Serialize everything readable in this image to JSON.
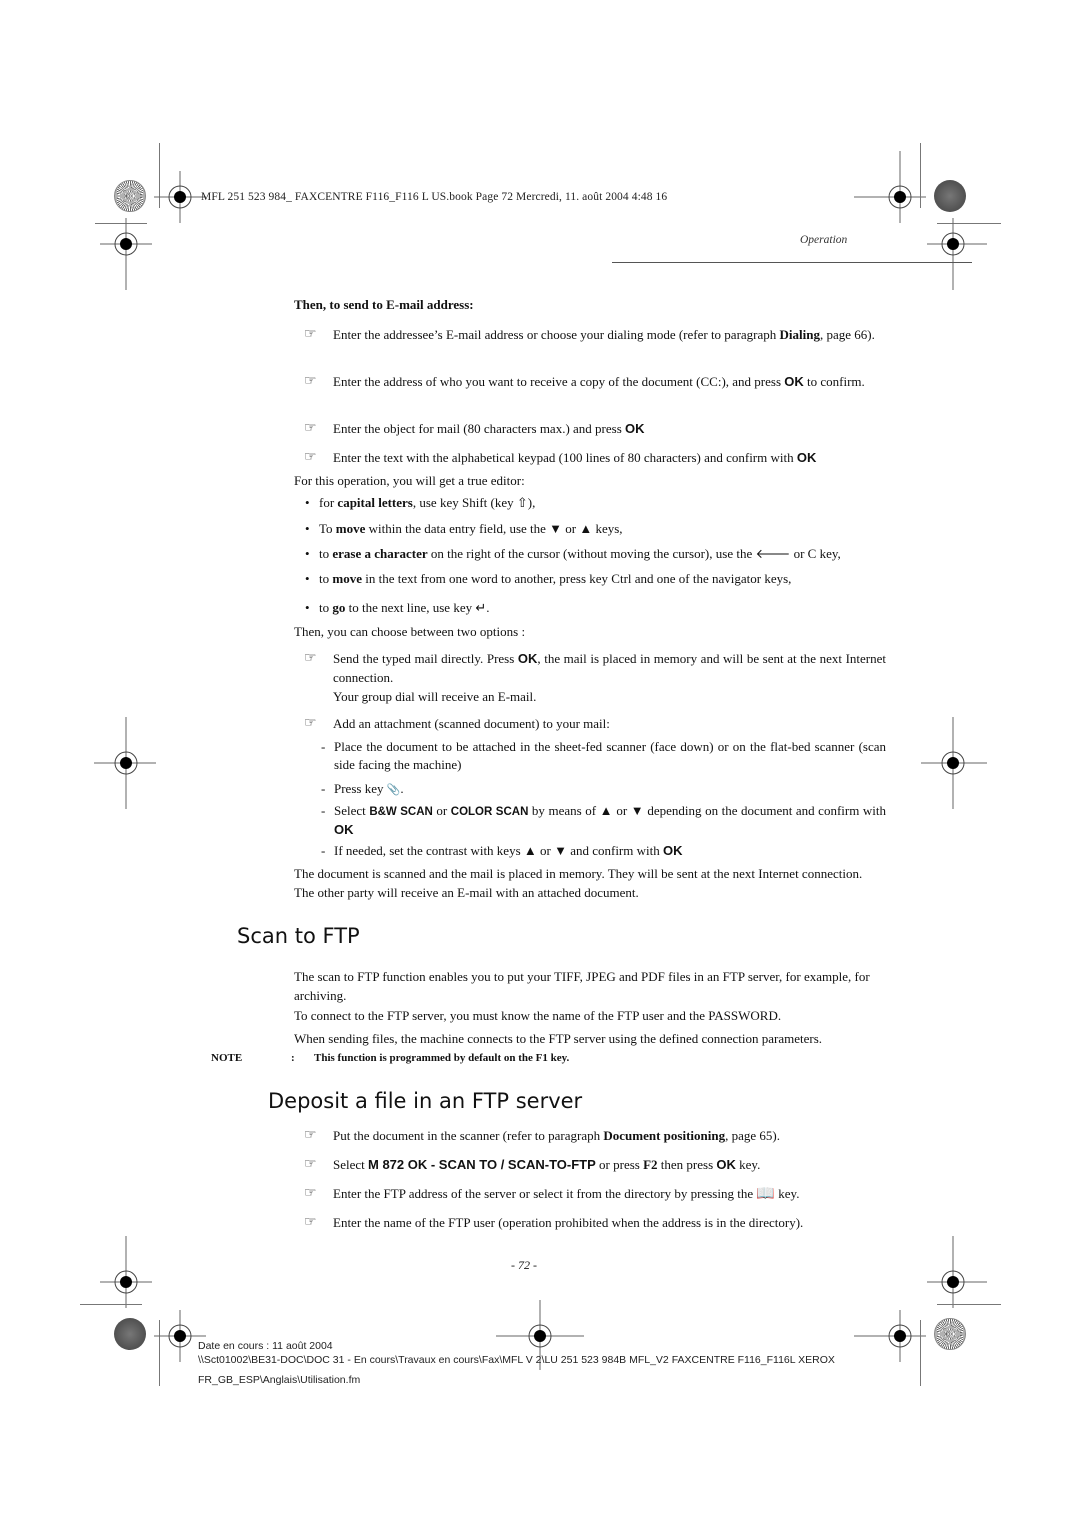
{
  "slug": "MFL 251 523 984_ FAXCENTRE F116_F116 L US.book  Page 72  Mercredi, 11. août 2004  4:48 16",
  "running_head": "Operation",
  "email_section": {
    "heading": "Then, to send to E-mail address:",
    "steps": [
      {
        "pre": "Enter the addressee’s E-mail address or choose your dialing mode (refer to paragraph ",
        "bold": "Dialing",
        "post": ", page 66)."
      },
      {
        "pre": "Enter the address of who you want to receive a copy of the document (CC:), and press ",
        "key": "OK",
        "post": " to confirm."
      },
      {
        "pre": "Enter the object for mail (80 characters max.) and press ",
        "key": "OK",
        "post": ""
      },
      {
        "pre": "Enter the text with the alphabetical keypad (100 lines of 80 characters) and confirm with ",
        "key": "OK",
        "post": ""
      }
    ],
    "editor_intro": "For this operation, you will get a true editor:",
    "editor_bullets": [
      {
        "pre": "for ",
        "bold": "capital letters",
        "post": ", use key Shift (key ⇧),"
      },
      {
        "pre": "To ",
        "bold": "move",
        "post": " within the data entry field, use the ▼ or ▲  keys,"
      },
      {
        "pre": "to ",
        "bold": "erase a character",
        "post": " on the right of the cursor (without moving the cursor), use the 🡐 or C key,"
      },
      {
        "pre": "to ",
        "bold": "move",
        "post": " in the text from one word to another, press key Ctrl and one of the navigator keys,"
      },
      {
        "pre": "to ",
        "bold": "go",
        "post": " to the next line, use key ↵."
      }
    ],
    "options_intro": "Then, you can choose between two options :",
    "option1": {
      "pre": "Send the typed mail directly. Press ",
      "key": "OK",
      "post": ", the mail is placed in memory and will be sent at the next Internet connection.",
      "line2": "Your group dial will receive an E-mail."
    },
    "option2": "Add an attachment (scanned document) to your mail:",
    "attachment_steps": [
      {
        "text": "Place the document to be attached in the sheet-fed scanner (face down) or on the flat-bed scanner (scan side facing the machine)"
      },
      {
        "pre": "Press key ",
        "post": "."
      },
      {
        "pre": "Select ",
        "key1": "B&W SCAN",
        "mid": " or ",
        "key2": "COLOR SCAN",
        "post": " by means of ▲ or ▼ depending on the document and confirm with ",
        "key3": "OK"
      },
      {
        "pre": "If needed, set the contrast with keys ▲ or ▼ and confirm with ",
        "key": "OK"
      }
    ],
    "closing": "The document is scanned and the mail is placed in memory. They will be sent at the next Internet connection. The other party will receive an E-mail with an attached document."
  },
  "ftp_section": {
    "heading": "Scan to FTP",
    "paragraphs": [
      "The scan to FTP function enables you to put your TIFF, JPEG and PDF files in an FTP server, for example, for archiving.",
      "To connect to the FTP server, you must know the name of the FTP user and the PASSWORD.",
      "When sending files, the machine connects to the FTP server using the defined connection parameters."
    ],
    "note_label": "NOTE",
    "note_colon": ":",
    "note_text": "This function is programmed by default on the F1 key."
  },
  "deposit_section": {
    "heading": "Deposit a file in an FTP server",
    "steps": [
      {
        "pre": "Put the document in the scanner (refer to paragraph ",
        "bold": "Document positioning",
        "post": ", page 65)."
      },
      {
        "pre": "Select ",
        "key": "M 872 OK - SCAN TO / SCAN-TO-FTP",
        "mid": " or press ",
        "bold": "F2",
        "mid2": " then press ",
        "key2": "OK",
        "post": " key."
      },
      {
        "pre": "Enter the FTP address of the server or select it from the directory by pressing the ",
        "post": " key."
      },
      {
        "pre": "Enter the name of the  FTP user (operation prohibited when the address is in the directory)."
      }
    ]
  },
  "page_number": "- 72 -",
  "footer": {
    "line1": "Date en cours : 11 août 2004",
    "line2": "\\\\Sct01002\\BE31-DOC\\DOC 31 - En cours\\Travaux en cours\\Fax\\MFL V 2\\LU 251 523 984B MFL_V2 FAXCENTRE F116_F116L XEROX",
    "line3": "FR_GB_ESP\\Anglais\\Utilisation.fm"
  }
}
